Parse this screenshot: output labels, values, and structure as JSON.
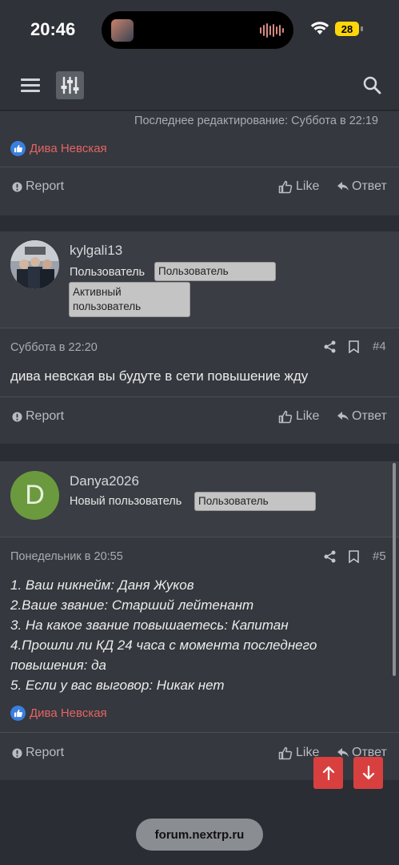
{
  "status": {
    "time": "20:46",
    "battery": "28"
  },
  "top_block": {
    "edited": "Последнее редактирование: Суббота в 22:19",
    "liker": "Дива Невская"
  },
  "actions": {
    "report": "Report",
    "like": "Like",
    "reply": "Ответ"
  },
  "posts": [
    {
      "username": "kylgali13",
      "role": "Пользователь",
      "badges": [
        "Пользователь",
        "Активный\nпользователь"
      ],
      "date": "Суббота в 22:20",
      "number": "#4",
      "text": "дива невская вы будуте в сети повышение жду"
    },
    {
      "username": "Danya2026",
      "avatar_letter": "D",
      "role": "Новый пользователь",
      "badges": [
        "Пользователь"
      ],
      "date": "Понедельник в 20:55",
      "number": "#5",
      "text_lines": [
        "1. Ваш никнейм: Даня Жуков",
        "2.Ваше звание: Старший лейтенант",
        "3. На какое звание повышаетесь: Капитан",
        "4.Прошли ли КД 24 часа с момента последнего",
        "повышения: да",
        "5. Если у вас выговор: Никак нет"
      ],
      "liker": "Дива Невская"
    }
  ],
  "url": "forum.nextrp.ru",
  "colors": {
    "accent_red": "#d8403f",
    "liker_red": "#e46464",
    "avatar_green": "#6b9a3e"
  }
}
